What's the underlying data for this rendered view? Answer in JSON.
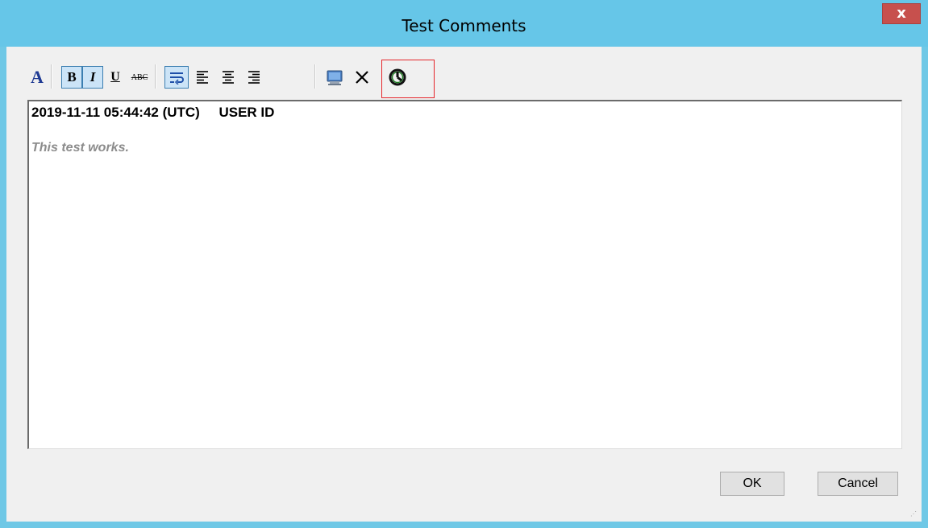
{
  "window": {
    "title": "Test Comments",
    "close_label": "x"
  },
  "toolbar": {
    "buttons": [
      {
        "name": "font-color",
        "label": "A",
        "icon": "font-color-icon"
      },
      {
        "name": "bold",
        "label": "B",
        "icon": "bold-icon",
        "pressed": true
      },
      {
        "name": "italic",
        "label": "I",
        "icon": "italic-icon",
        "pressed": true
      },
      {
        "name": "underline",
        "label": "U",
        "icon": "underline-icon"
      },
      {
        "name": "strikethrough",
        "label": "ABC",
        "icon": "strikethrough-icon"
      },
      {
        "name": "word-wrap",
        "icon": "word-wrap-icon",
        "pressed": true
      },
      {
        "name": "align-left",
        "icon": "align-left-icon"
      },
      {
        "name": "align-center",
        "icon": "align-center-icon"
      },
      {
        "name": "align-right",
        "icon": "align-right-icon"
      },
      {
        "name": "insert-image",
        "icon": "insert-image-icon"
      },
      {
        "name": "delete",
        "icon": "close-icon"
      },
      {
        "name": "timestamp",
        "icon": "clock-icon"
      }
    ]
  },
  "editor": {
    "header": "2019-11-11 05:44:42 (UTC)     USER ID",
    "body": "This test works."
  },
  "dialog": {
    "ok_label": "OK",
    "cancel_label": "Cancel"
  },
  "colors": {
    "titlebar": "#66c6e8",
    "close_button": "#c7504d",
    "highlight": "#e5262b",
    "clock_icon": "#1e7a23"
  }
}
